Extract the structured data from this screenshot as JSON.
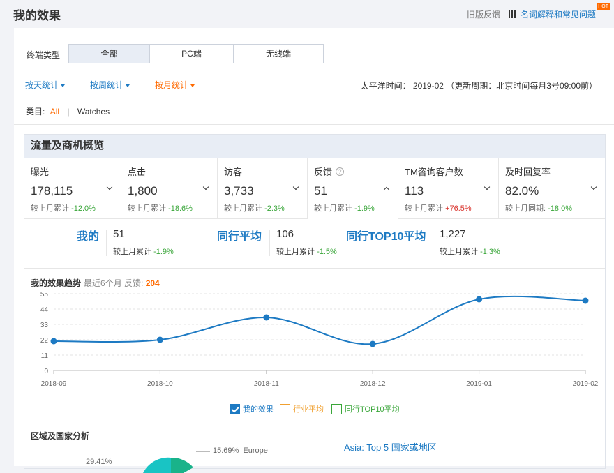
{
  "header": {
    "title": "我的效果",
    "old_feedback": "旧版反馈",
    "faq_link": "名词解释和常见问题",
    "hot_badge": "HOT"
  },
  "terminal": {
    "label": "终端类型",
    "options": [
      "全部",
      "PC端",
      "无线端"
    ],
    "selected": "全部"
  },
  "stat_tabs": [
    {
      "label": "按天统计"
    },
    {
      "label": "按周统计"
    },
    {
      "label": "按月统计"
    }
  ],
  "time_info": "太平洋时间： 2019-02 （更新周期：北京时间每月3号09:00前）",
  "category": {
    "label": "类目:",
    "all": "All",
    "sep": "|",
    "item": "Watches"
  },
  "panel": {
    "title": "流量及商机概览",
    "metrics": [
      {
        "label": "曝光",
        "value": "178,115",
        "prefix": "较上月累计",
        "change": "-12.0%",
        "trend": "down"
      },
      {
        "label": "点击",
        "value": "1,800",
        "prefix": "较上月累计",
        "change": "-18.6%",
        "trend": "down"
      },
      {
        "label": "访客",
        "value": "3,733",
        "prefix": "较上月累计",
        "change": "-2.3%",
        "trend": "down"
      },
      {
        "label": "反馈",
        "value": "51",
        "prefix": "较上月累计",
        "change": "-1.9%",
        "trend": "down",
        "help": "?"
      },
      {
        "label": "TM咨询客户数",
        "value": "113",
        "prefix": "较上月累计",
        "change": "+76.5%",
        "trend": "up"
      },
      {
        "label": "及时回复率",
        "value": "82.0%",
        "prefix": "较上月同期:",
        "change": "-18.0%",
        "trend": "down"
      }
    ],
    "compare": {
      "mine": {
        "label": "我的",
        "value": "51",
        "prefix": "较上月累计",
        "change": "-1.9%"
      },
      "peer": {
        "label": "同行平均",
        "value": "106",
        "prefix": "较上月累计",
        "change": "-1.5%"
      },
      "top10": {
        "label": "同行TOP10平均",
        "value": "1,227",
        "prefix": "较上月累计",
        "change": "-1.3%"
      }
    },
    "trend": {
      "title": "我的效果趋势",
      "sub": "最近6个月 反馈:",
      "total": "204"
    },
    "legend": [
      {
        "label": "我的效果",
        "color": "#1d7ac3",
        "checked": true
      },
      {
        "label": "行业平均",
        "color": "#f0a030",
        "checked": false
      },
      {
        "label": "同行TOP10平均",
        "color": "#3aa63a",
        "checked": false
      }
    ],
    "region": {
      "title": "区域及国家分析",
      "asia_title": "Asia: Top 5 国家或地区",
      "pie_labels": [
        {
          "pct": "15.69%",
          "name": "Europe"
        },
        {
          "pct": "29.41%",
          "name": ""
        }
      ]
    }
  },
  "chart_data": {
    "type": "line",
    "x": [
      "2018-09",
      "2018-10",
      "2018-11",
      "2018-12",
      "2019-01",
      "2019-02"
    ],
    "series": [
      {
        "values": [
          21,
          22,
          38,
          19,
          51,
          50
        ],
        "color": "#1d7ac3"
      }
    ],
    "yticks": [
      0,
      11,
      22,
      33,
      44,
      55
    ],
    "ylim": [
      0,
      55
    ],
    "grid": "horizontal-dashed"
  }
}
